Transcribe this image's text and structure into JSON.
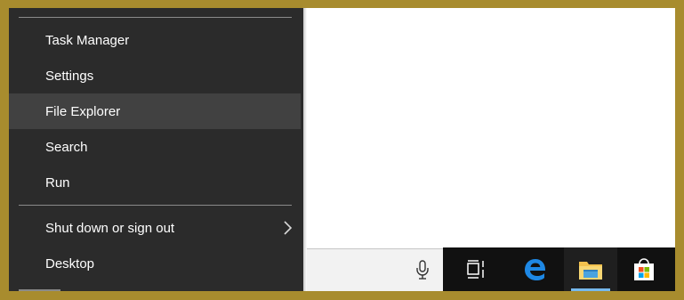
{
  "menu": {
    "items": [
      {
        "label": "Task Manager"
      },
      {
        "label": "Settings"
      },
      {
        "label": "File Explorer"
      },
      {
        "label": "Search"
      },
      {
        "label": "Run"
      },
      {
        "label": "Shut down or sign out"
      },
      {
        "label": "Desktop"
      }
    ],
    "hovered": "File Explorer"
  },
  "taskbar": {
    "icons": [
      "task-view-icon",
      "edge-icon",
      "file-explorer-icon",
      "store-icon"
    ],
    "active": "file-explorer-icon"
  },
  "search": {
    "icon": "microphone-icon"
  },
  "colors": {
    "menu_bg": "#2b2b2b",
    "menu_hover": "#414141",
    "taskbar_bg": "#111111",
    "accent": "#76b9ed",
    "desktop_border": "#a88c2e"
  }
}
